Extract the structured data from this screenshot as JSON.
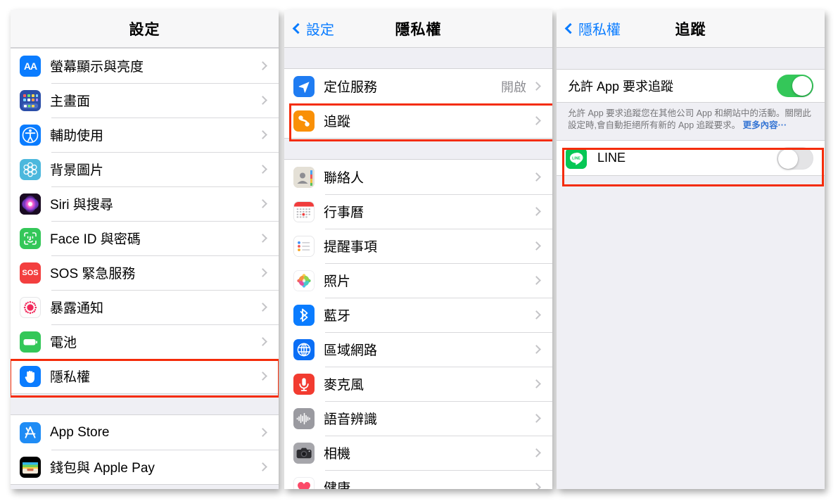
{
  "meta": {
    "accent_blue": "#0a7cff",
    "highlight_red": "#f42c0a",
    "toggle_on_green": "#34c759",
    "group_bg": "#efeff4"
  },
  "panel_settings": {
    "title": "設定",
    "groups": [
      {
        "rows": [
          {
            "label": "螢幕顯示與亮度",
            "icon": "display-brightness-icon",
            "value": ""
          },
          {
            "label": "主畫面",
            "icon": "home-screen-icon",
            "value": ""
          },
          {
            "label": "輔助使用",
            "icon": "accessibility-icon",
            "value": ""
          },
          {
            "label": "背景圖片",
            "icon": "wallpaper-icon",
            "value": ""
          },
          {
            "label": "Siri 與搜尋",
            "icon": "siri-icon",
            "value": ""
          },
          {
            "label": "Face ID 與密碼",
            "icon": "face-id-icon",
            "value": ""
          },
          {
            "label": "SOS 緊急服務",
            "icon": "sos-icon",
            "value": ""
          },
          {
            "label": "暴露通知",
            "icon": "exposure-notification-icon",
            "value": ""
          },
          {
            "label": "電池",
            "icon": "battery-icon",
            "value": ""
          },
          {
            "label": "隱私權",
            "icon": "privacy-hand-icon",
            "value": "",
            "highlighted": true
          }
        ]
      },
      {
        "rows": [
          {
            "label": "App Store",
            "icon": "app-store-icon",
            "value": ""
          },
          {
            "label": "錢包與 Apple Pay",
            "icon": "wallet-icon",
            "value": ""
          }
        ]
      }
    ]
  },
  "panel_privacy": {
    "back_label": "設定",
    "title": "隱私權",
    "groups": [
      {
        "rows": [
          {
            "label": "定位服務",
            "icon": "location-services-icon",
            "value": "開啟"
          },
          {
            "label": "追蹤",
            "icon": "tracking-icon",
            "value": "",
            "highlighted": true
          }
        ]
      },
      {
        "rows": [
          {
            "label": "聯絡人",
            "icon": "contacts-icon",
            "value": ""
          },
          {
            "label": "行事曆",
            "icon": "calendar-icon",
            "value": ""
          },
          {
            "label": "提醒事項",
            "icon": "reminders-icon",
            "value": ""
          },
          {
            "label": "照片",
            "icon": "photos-icon",
            "value": ""
          },
          {
            "label": "藍牙",
            "icon": "bluetooth-icon",
            "value": ""
          },
          {
            "label": "區域網路",
            "icon": "local-network-icon",
            "value": ""
          },
          {
            "label": "麥克風",
            "icon": "microphone-icon",
            "value": ""
          },
          {
            "label": "語音辨識",
            "icon": "speech-recognition-icon",
            "value": ""
          },
          {
            "label": "相機",
            "icon": "camera-icon",
            "value": ""
          },
          {
            "label": "健康",
            "icon": "health-icon",
            "value": ""
          }
        ]
      }
    ]
  },
  "panel_tracking": {
    "back_label": "隱私權",
    "title": "追蹤",
    "allow_toggle": {
      "label": "允許 App 要求追蹤",
      "state": "on"
    },
    "footer": {
      "text": "允許 App 要求追蹤您在其他公司 App 和網站中的活動。關閉此設定時,會自動拒絕所有新的 App 追蹤要求。 ",
      "link": "更多內容···"
    },
    "apps": [
      {
        "name": "LINE",
        "icon": "line-app-icon",
        "state": "off",
        "highlighted": true
      }
    ]
  }
}
